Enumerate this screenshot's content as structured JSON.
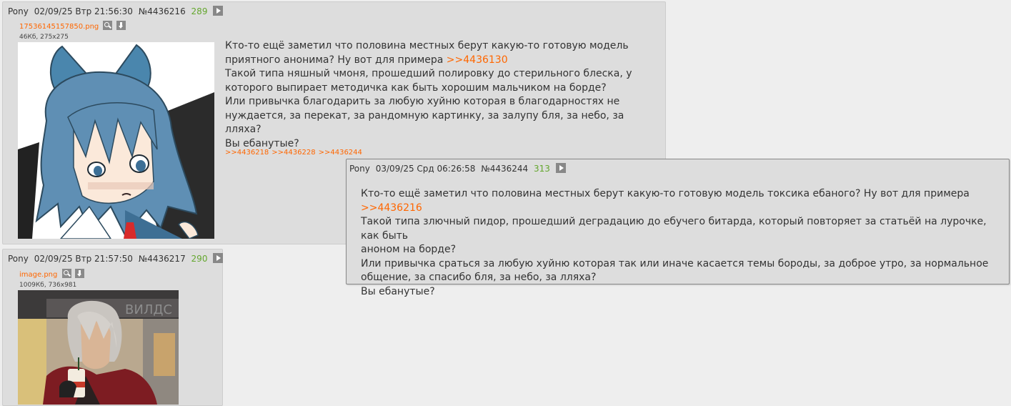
{
  "posts": [
    {
      "name": "Pony",
      "date": "02/09/25 Втр 21:56:30",
      "num": "№4436216",
      "count": "289",
      "file_name": "17536145157850.png",
      "file_meta": "46Кб, 275x275",
      "lines": [
        "Кто-то ещё заметил что половина местных берут какую-то готовую модель",
        "приятного анонима? Ну вот для примера ",
        "Такой типа няшный чмоня, прошедший полировку до стерильного блеска, у",
        "которого выпирает методичка как быть хорошим мальчиком на борде?",
        "Или привычка благодарить за любую хуйню которая в благодарностях не",
        "нуждается, за перекат, за рандомную картинку, за залупу бля, за небо, за лляха?",
        "Вы ебанутые?"
      ],
      "quote_link": ">>4436130",
      "backlinks": [
        ">>4436218",
        ">>4436228",
        ">>4436244"
      ]
    },
    {
      "name": "Pony",
      "date": "02/09/25 Втр 21:57:50",
      "num": "№4436217",
      "count": "290",
      "file_name": "image.png",
      "file_meta": "1009Кб, 736x981"
    }
  ],
  "popup": {
    "name": "Pony",
    "date": "03/09/25 Срд 06:26:58",
    "num": "№4436244",
    "count": "313",
    "line1": "Кто-то ещё заметил что половина местных берут какую-то готовую модель токсика ебаного? Ну вот для примера ",
    "quote_link": ">>4436216",
    "lines": [
      "Такой типа злючный пидор, прошедший деградацию до ебучего битарда, который повторяет за статьёй на лурочке, как быть",
      "аноном на борде?",
      "Или привычка сраться за любую хуйню которая так или иначе касается темы бороды, за доброе утро, за нормальное",
      "общение, за спасибо бля, за небо, за лляха?",
      "Вы ебанутые?"
    ]
  },
  "colors": {
    "background": "#eeeeee",
    "post_bg": "#dddddd",
    "link": "#ff6600",
    "score": "#64a72e"
  },
  "icons": [
    "play-icon",
    "magnify-icon",
    "download-icon"
  ]
}
